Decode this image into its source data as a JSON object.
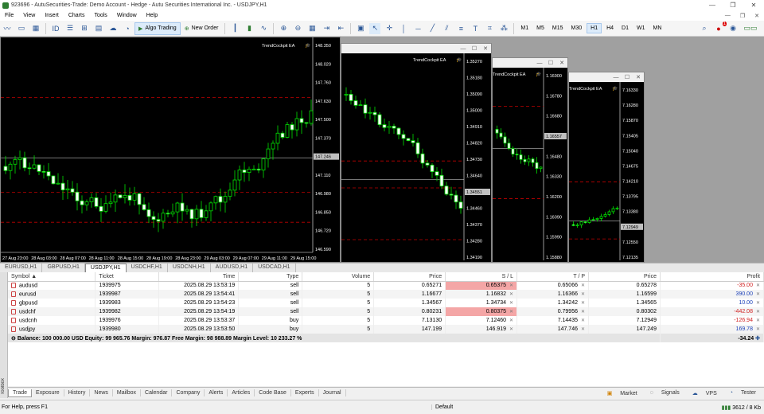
{
  "window": {
    "title": "923696 - AutuSecurities-Trade: Demo Account - Hedge - Autu Securities International Inc. - USDJPY,H1",
    "min": "—",
    "max": "❐",
    "close": "✕"
  },
  "menu": [
    "File",
    "View",
    "Insert",
    "Charts",
    "Tools",
    "Window",
    "Help"
  ],
  "toolbar": {
    "algo_trading": "Algo Trading",
    "new_order": "New Order",
    "timeframes": [
      "M1",
      "M5",
      "M15",
      "M30",
      "H1",
      "H4",
      "D1",
      "W1",
      "MN"
    ],
    "selected_timeframe": "H1",
    "notif_count": "1"
  },
  "charts": [
    {
      "name": "USDJPY,H1",
      "ea": "TrendCockpit EA",
      "price_labels": [
        "148.350",
        "148.020",
        "147.760",
        "147.630",
        "147.500",
        "147.370",
        "147.246",
        "147.110",
        "146.980",
        "146.850",
        "146.720",
        "146.590"
      ],
      "current_price": "147.246",
      "time_labels": [
        "27 Aug 23:00",
        "28 Aug 03:00",
        "28 Aug 07:00",
        "28 Aug 11:00",
        "28 Aug 15:00",
        "28 Aug 19:00",
        "28 Aug 23:00",
        "29 Aug 03:00",
        "29 Aug 07:00",
        "29 Aug 11:00",
        "29 Aug 15:00"
      ]
    },
    {
      "name": "win2",
      "ea": "TrendCockpit EA",
      "price_labels": [
        "1.35270",
        "1.35180",
        "1.35090",
        "1.35000",
        "1.34910",
        "1.34820",
        "1.34730",
        "1.34640",
        "1.34551",
        "1.34460",
        "1.34370",
        "1.34280",
        "1.34190"
      ],
      "current_price": "1.34551"
    },
    {
      "name": "win3",
      "ea": "TrendCockpit EA",
      "price_labels": [
        "1.16900",
        "1.16780",
        "1.16680",
        "1.16557",
        "1.16480",
        "1.16330",
        "1.16200",
        "1.16090",
        "1.15990",
        "1.15880"
      ],
      "current_price": "1.16557"
    },
    {
      "name": "win4",
      "ea": "TrendCockpit EA",
      "price_labels": [
        "7.16330",
        "7.16280",
        "7.15870",
        "7.15405",
        "7.15040",
        "7.14675",
        "7.14210",
        "7.13795",
        "7.13380",
        "7.12949",
        "7.12550",
        "7.12135"
      ],
      "current_price": "7.12949"
    }
  ],
  "chart_tabs": [
    "EURUSD,H1",
    "GBPUSD,H1",
    "USDJPY,H1",
    "USDCHF,H1",
    "USDCNH,H1",
    "AUDUSD,H1",
    "USDCAD,H1"
  ],
  "active_chart_tab": "USDJPY,H1",
  "trade": {
    "columns": [
      "Symbol",
      "Ticket",
      "Time",
      "Type",
      "Volume",
      "Price",
      "S / L",
      "T / P",
      "Price",
      "Profit"
    ],
    "rows": [
      {
        "symbol": "audusd",
        "ticket": "1939975",
        "time": "2025.08.29 13:53:19",
        "type": "sell",
        "volume": "5",
        "price": "0.65271",
        "sl": "0.65375",
        "tp": "0.65066",
        "cur": "0.65278",
        "profit": "-35.00"
      },
      {
        "symbol": "eurusd",
        "ticket": "1939987",
        "time": "2025.08.29 13:54:41",
        "type": "sell",
        "volume": "5",
        "price": "1.16677",
        "sl": "1.16832",
        "tp": "1.16366",
        "cur": "1.16599",
        "profit": "390.00"
      },
      {
        "symbol": "gbpusd",
        "ticket": "1939983",
        "time": "2025.08.29 13:54:23",
        "type": "sell",
        "volume": "5",
        "price": "1.34567",
        "sl": "1.34734",
        "tp": "1.34242",
        "cur": "1.34565",
        "profit": "10.00"
      },
      {
        "symbol": "usdchf",
        "ticket": "1939982",
        "time": "2025.08.29 13:54:19",
        "type": "sell",
        "volume": "5",
        "price": "0.80231",
        "sl": "0.80375",
        "tp": "0.79956",
        "cur": "0.80302",
        "profit": "-442.08"
      },
      {
        "symbol": "usdcnh",
        "ticket": "1939976",
        "time": "2025.08.29 13:53:37",
        "type": "buy",
        "volume": "5",
        "price": "7.13130",
        "sl": "7.12460",
        "tp": "7.14435",
        "cur": "7.12949",
        "profit": "-126.94"
      },
      {
        "symbol": "usdjpy",
        "ticket": "1939980",
        "time": "2025.08.29 13:53:50",
        "type": "buy",
        "volume": "5",
        "price": "147.199",
        "sl": "146.919",
        "tp": "147.746",
        "cur": "147.249",
        "profit": "169.78"
      }
    ],
    "balance_line": "Balance: 100 000.00 USD  Equity: 99 965.76  Margin: 976.87  Free Margin: 98 988.89  Margin Level: 10 233.27 %",
    "total_profit": "-34.24"
  },
  "bottom_tabs": [
    "Trade",
    "Exposure",
    "History",
    "News",
    "Mailbox",
    "Calendar",
    "Company",
    "Alerts",
    "Articles",
    "Code Base",
    "Experts",
    "Journal"
  ],
  "bottom_right": [
    "Market",
    "Signals",
    "VPS",
    "Tester"
  ],
  "toolbox_label": "Toolbox",
  "status": {
    "help": "For Help, press F1",
    "profile": "Default",
    "traffic": "3612 / 8 Kb"
  },
  "colors": {
    "bull": "#ffffff",
    "bear": "#00e000",
    "level": "#c00000"
  }
}
